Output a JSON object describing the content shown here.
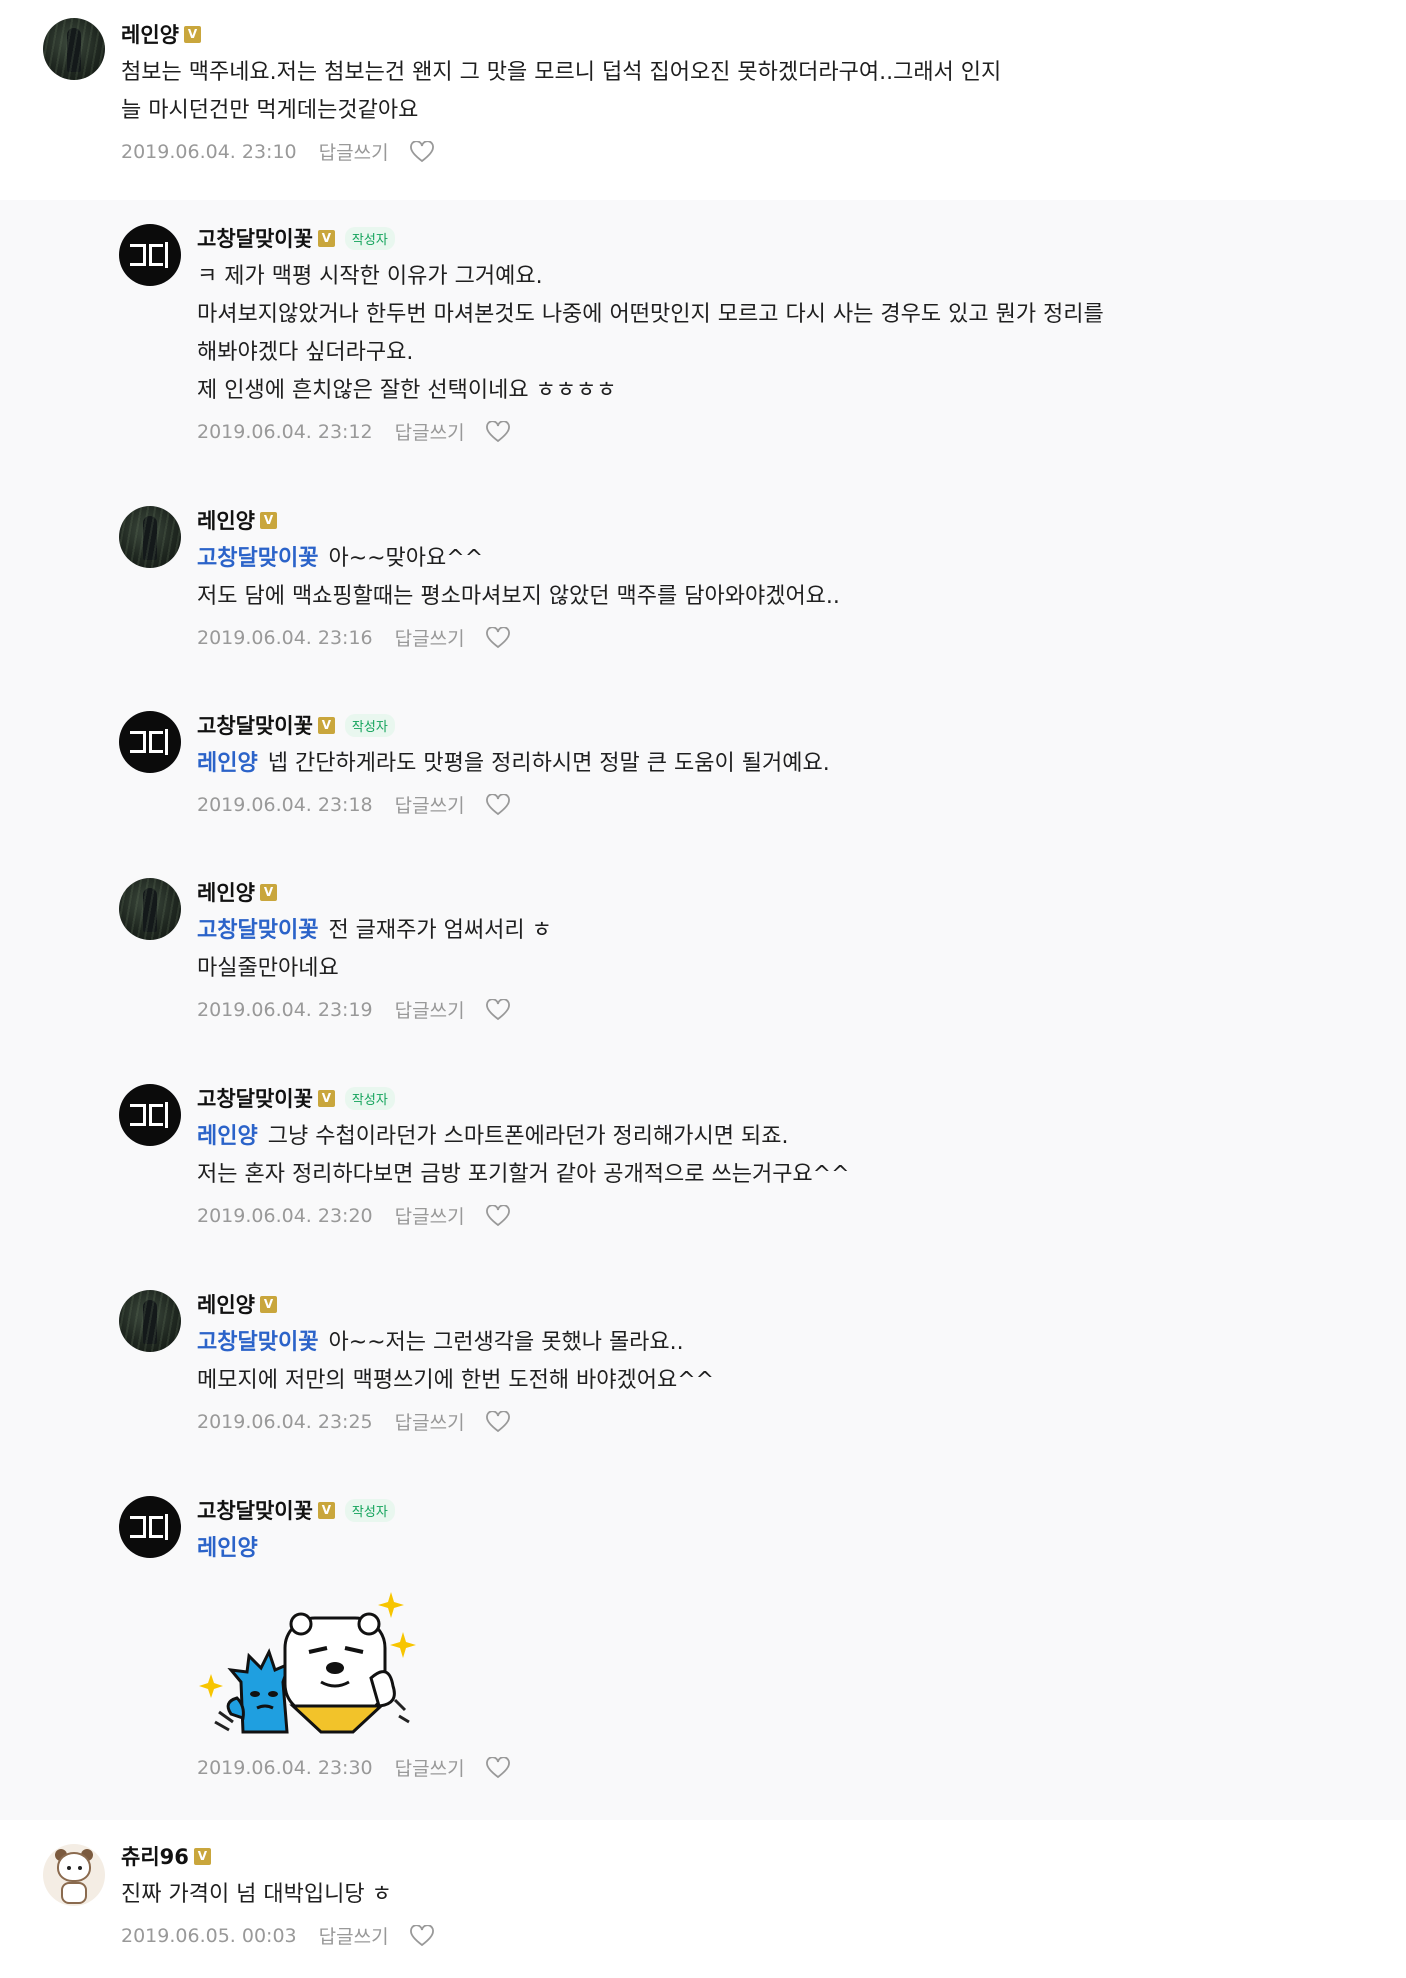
{
  "comments": [
    {
      "author": "레인양",
      "badge": "V",
      "lines": [
        "첨보는 맥주네요.저는 첨보는건 왠지 그 맛을 모르니 덥석 집어오진 못하겠더라구여..그래서 인지",
        "늘 마시던건만 먹게데는것같아요"
      ],
      "date": "2019.06.04. 23:10",
      "reply": "답글쓰기"
    },
    {
      "author": "고창달맞이꽃",
      "badge": "V",
      "writer": "작성자",
      "lines": [
        "ㅋ 제가 맥평 시작한 이유가 그거예요.",
        "마셔보지않았거나 한두번 마셔본것도 나중에 어떤맛인지 모르고 다시 사는 경우도 있고 뭔가 정리를",
        "해봐야겠다 싶더라구요.",
        "제 인생에 흔치않은 잘한 선택이네요 ㅎㅎㅎㅎ"
      ],
      "date": "2019.06.04. 23:12",
      "reply": "답글쓰기"
    },
    {
      "author": "레인양",
      "badge": "V",
      "mention": "고창달맞이꽃",
      "lines": [
        "아~~맞아요^^",
        "저도 담에 맥쇼핑할때는 평소마셔보지 않았던 맥주를 담아와야겠어요.."
      ],
      "date": "2019.06.04. 23:16",
      "reply": "답글쓰기"
    },
    {
      "author": "고창달맞이꽃",
      "badge": "V",
      "writer": "작성자",
      "mention": "레인양",
      "lines": [
        "넵 간단하게라도 맛평을 정리하시면 정말 큰 도움이 될거예요."
      ],
      "date": "2019.06.04. 23:18",
      "reply": "답글쓰기"
    },
    {
      "author": "레인양",
      "badge": "V",
      "mention": "고창달맞이꽃",
      "lines": [
        "전 글재주가 엄써서리 ㅎ",
        "마실줄만아네요"
      ],
      "date": "2019.06.04. 23:19",
      "reply": "답글쓰기"
    },
    {
      "author": "고창달맞이꽃",
      "badge": "V",
      "writer": "작성자",
      "mention": "레인양",
      "lines": [
        "그냥 수첩이라던가 스마트폰에라던가 정리해가시면 되죠.",
        "저는 혼자 정리하다보면 금방 포기할거 같아 공개적으로 쓰는거구요^^"
      ],
      "date": "2019.06.04. 23:20",
      "reply": "답글쓰기"
    },
    {
      "author": "레인양",
      "badge": "V",
      "mention": "고창달맞이꽃",
      "lines": [
        "아~~저는 그런생각을 못했나 몰라요..",
        "메모지에 저만의 맥평쓰기에 한번 도전해 바야겠어요^^"
      ],
      "date": "2019.06.04. 23:25",
      "reply": "답글쓰기"
    },
    {
      "author": "고창달맞이꽃",
      "badge": "V",
      "writer": "작성자",
      "mention": "레인양",
      "lines": [],
      "date": "2019.06.04. 23:30",
      "reply": "답글쓰기"
    },
    {
      "author": "츄리96",
      "badge": "V",
      "lines": [
        "진짜 가격이 넘 대박입니당 ㅎ"
      ],
      "date": "2019.06.05. 00:03",
      "reply": "답글쓰기"
    }
  ],
  "icons": {
    "heart": "heart-outline-icon",
    "sticker": "emoticon-sticker"
  },
  "colors": {
    "mention": "#2b63c9",
    "writer_tag": "#13a35b",
    "badge": "#c9a63c",
    "reply_bg": "#f9f9fa"
  }
}
